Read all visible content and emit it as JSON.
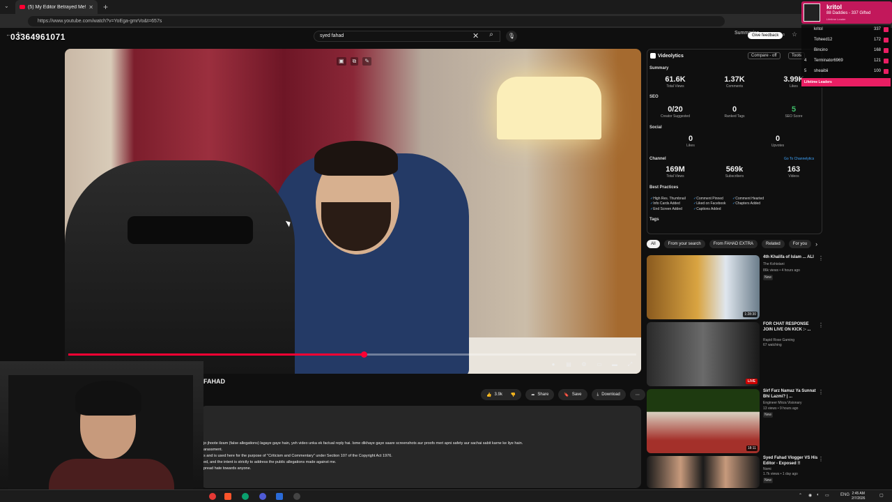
{
  "browser": {
    "tab_title": "(5) My Editor Betrayed Me! Th",
    "url": "https://www.youtube.com/watch?v=YoEga-gmrVo&t=657s",
    "summarise_label": "Summarise"
  },
  "overlay": {
    "phone": "03364961071"
  },
  "youtube": {
    "search_value": "syed fahad",
    "feedback_label": "Give feedback"
  },
  "video": {
    "progress_pct": 0.52,
    "title_fragment": "FAHAD",
    "likes": "3.9k",
    "share_label": "Share",
    "save_label": "Save",
    "download_label": "Download",
    "description": [
      "jo jhoote ilzam (false allegations) lagaye gaye hain, yeh video unka ek factual reply hai. Isme dikhaye gaye saare screenshots aur proofs meri apni safety aur sachai sabit karne ke liye hain.",
      "arassment.",
      "s and is used here for the purpose of \"Criticism and Commentary\" under Section 107 of the Copyright Act 1976.",
      "ed, and the intent is strictly to address the public allegations made against me.",
      "pread hate towards anyone."
    ]
  },
  "analytics": {
    "brand": "Videolytics",
    "compare": "Compare - off",
    "tools": "Tools",
    "summary_title": "Summary",
    "summary": [
      {
        "value": "61.6K",
        "label": "Total Views"
      },
      {
        "value": "1.37K",
        "label": "Comments"
      },
      {
        "value": "3.99K",
        "label": "Likes"
      }
    ],
    "seo_title": "SEO",
    "seo": [
      {
        "value": "0/20",
        "label": "Creator Suggested"
      },
      {
        "value": "0",
        "label": "Ranked Tags"
      },
      {
        "value": "5",
        "label": "SEO Score"
      }
    ],
    "social_title": "Social",
    "social": [
      {
        "value": "0",
        "label": "Likes"
      },
      {
        "value": "0",
        "label": "Upvotes"
      }
    ],
    "channel_title": "Channel",
    "channel_link": "Go To Channelytics",
    "channel": [
      {
        "value": "169M",
        "label": "Total Views"
      },
      {
        "value": "569k",
        "label": "Subscribers"
      },
      {
        "value": "163",
        "label": "Videos"
      }
    ],
    "best_practices_title": "Best Practices",
    "best_practices": [
      "High Res. Thumbnail",
      "Comment Pinned",
      "Comment Hearted",
      "Info Cards Added",
      "Liked on Facebook",
      "Chapters Added",
      "End Screen Added",
      "Captions Added"
    ],
    "tags_title": "Tags"
  },
  "chips": [
    "All",
    "From your search",
    "From FAHAD EXTRA",
    "Related",
    "For you"
  ],
  "recommended": [
    {
      "title": "4th Khalifa of Islam ... ALI",
      "channel": "The Kohistani",
      "meta": "86k views • 4 hours ago",
      "badge": "New",
      "duration": "1:28:30"
    },
    {
      "title": "FOR CHAT RESPONSE JOIN LIVE ON KICK :- ...",
      "channel": "Rapid Rose Gaming",
      "meta": "67 watching",
      "badge": "",
      "duration": "LIVE"
    },
    {
      "title": "Sirf Farz Namaz Ya Sunnat Bhi Lazmi? | ...",
      "channel": "Engineer Mirza Visionary",
      "meta": "13 views • 9 hours ago",
      "badge": "New",
      "duration": "18:11"
    },
    {
      "title": "Syed Fahad Vlogger VS His Editor - Exposed !!",
      "channel": "Nomi",
      "meta": "1.7k views • 1 day ago",
      "badge": "New",
      "duration": ""
    }
  ],
  "stream_alert": {
    "name": "kritol",
    "text": "88 Daddies - 337 Gifted",
    "sub": "Lifetime Leader"
  },
  "leaderboard": {
    "rows": [
      {
        "rank": "",
        "name": "kritol",
        "count": "337"
      },
      {
        "rank": "",
        "name": "Toheed12",
        "count": "172"
      },
      {
        "rank": "",
        "name": "Bincino",
        "count": "168"
      },
      {
        "rank": "4",
        "name": "Terminator6969",
        "count": "121"
      },
      {
        "rank": "5",
        "name": "sheaibii",
        "count": "100"
      }
    ],
    "footer": "Lifetime Leaders"
  },
  "taskbar": {
    "lang": "ENG",
    "time": "2:45 AM",
    "date": "2/7/2026"
  },
  "colors": {
    "accent": "#ff0033",
    "overlay_pink": "#e91e63"
  }
}
